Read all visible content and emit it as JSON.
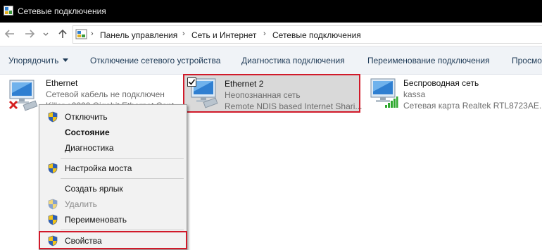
{
  "window": {
    "title": "Сетевые подключения"
  },
  "address": {
    "crumbs": [
      "Панель управления",
      "Сеть и Интернет",
      "Сетевые подключения"
    ],
    "separator": "›"
  },
  "commands": {
    "organize": "Упорядочить",
    "disable_device": "Отключение сетевого устройства",
    "diagnose": "Диагностика подключения",
    "rename": "Переименование подключения",
    "view_status": "Просмо"
  },
  "connections": [
    {
      "name": "Ethernet",
      "status": "Сетевой кабель не подключен",
      "adapter": "Killer e2200 Gigabit Ethernet Cont..."
    },
    {
      "name": "Ethernet 2",
      "status": "Неопознанная сеть",
      "adapter": "Remote NDIS based Internet Shari...",
      "selected": true
    },
    {
      "name": "Беспроводная сеть",
      "status": "kassa",
      "adapter": "Сетевая карта Realtek RTL8723AE..."
    }
  ],
  "context_menu": {
    "items": [
      {
        "label": "Отключить",
        "shield": true
      },
      {
        "label": "Состояние",
        "bold": true
      },
      {
        "label": "Диагностика"
      },
      {
        "label": "Настройка моста",
        "shield": true
      },
      {
        "label": "Создать ярлык"
      },
      {
        "label": "Удалить",
        "shield": true,
        "disabled": true
      },
      {
        "label": "Переименовать",
        "shield": true
      },
      {
        "label": "Свойства",
        "shield": true,
        "highlighted": true
      }
    ]
  },
  "colors": {
    "titlebar": "#000000",
    "commandbar": "#f0f3f7",
    "highlight_border": "#d11a2a",
    "selection": "#d9d9d9",
    "menu_bg": "#f2f2f2"
  },
  "icons": [
    "app-icon",
    "back-arrow-icon",
    "forward-arrow-icon",
    "up-arrow-icon",
    "network-folder-icon",
    "ethernet-icon",
    "disconnected-x-icon",
    "wifi-bars-icon",
    "shield-icon",
    "checkbox-icon"
  ]
}
